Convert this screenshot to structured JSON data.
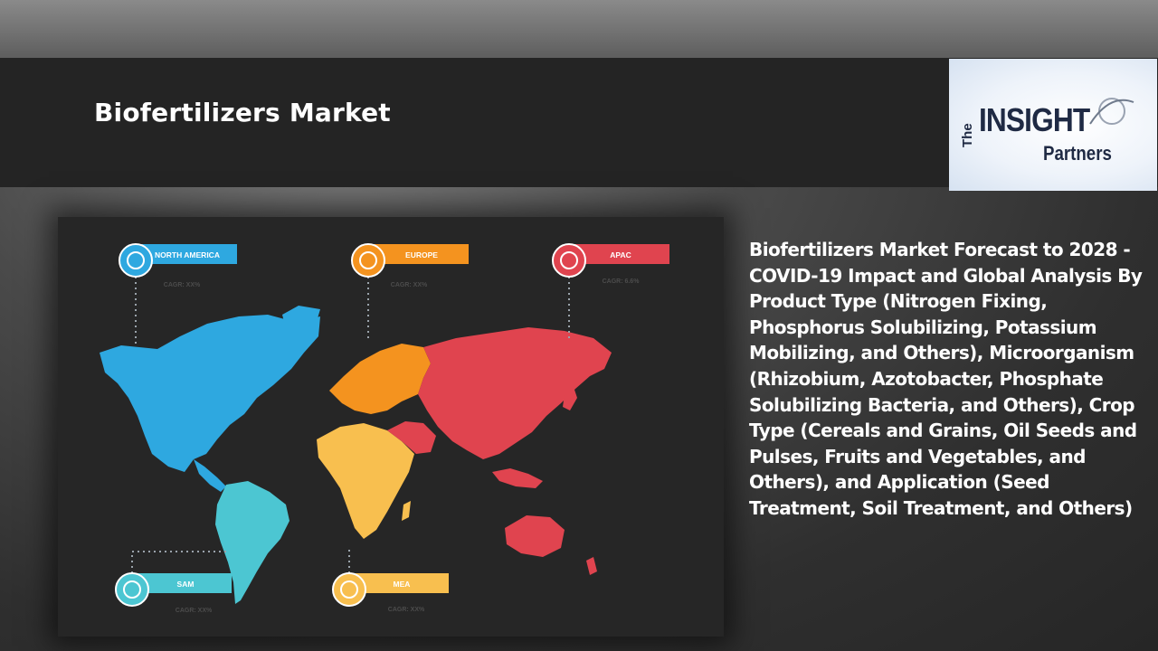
{
  "header": {
    "title": "Biofertilizers Market"
  },
  "logo": {
    "the": "The",
    "insight": "INSIGHT",
    "partners": "Partners"
  },
  "description": "Biofertilizers Market Forecast to 2028 - COVID-19 Impact and Global Analysis By Product Type (Nitrogen Fixing, Phosphorus Solubilizing, Potassium Mobilizing, and Others), Microorganism (Rhizobium, Azotobacter, Phosphate Solubilizing Bacteria, and Others), Crop Type (Cereals and Grains, Oil Seeds and Pulses, Fruits and Vegetables, and Others), and Application (Seed Treatment, Soil Treatment, and Others)",
  "regions": {
    "north_america": {
      "label": "NORTH AMERICA",
      "cagr": "CAGR: XX%",
      "color": "#2ea8e0"
    },
    "europe": {
      "label": "EUROPE",
      "cagr": "CAGR: XX%",
      "color": "#f4931f"
    },
    "apac": {
      "label": "APAC",
      "cagr": "CAGR: 6.6%",
      "color": "#e0444f"
    },
    "sam": {
      "label": "SAM",
      "cagr": "CAGR: XX%",
      "color": "#4cc6d2"
    },
    "mea": {
      "label": "MEA",
      "cagr": "CAGR: XX%",
      "color": "#f8bf4f"
    }
  }
}
